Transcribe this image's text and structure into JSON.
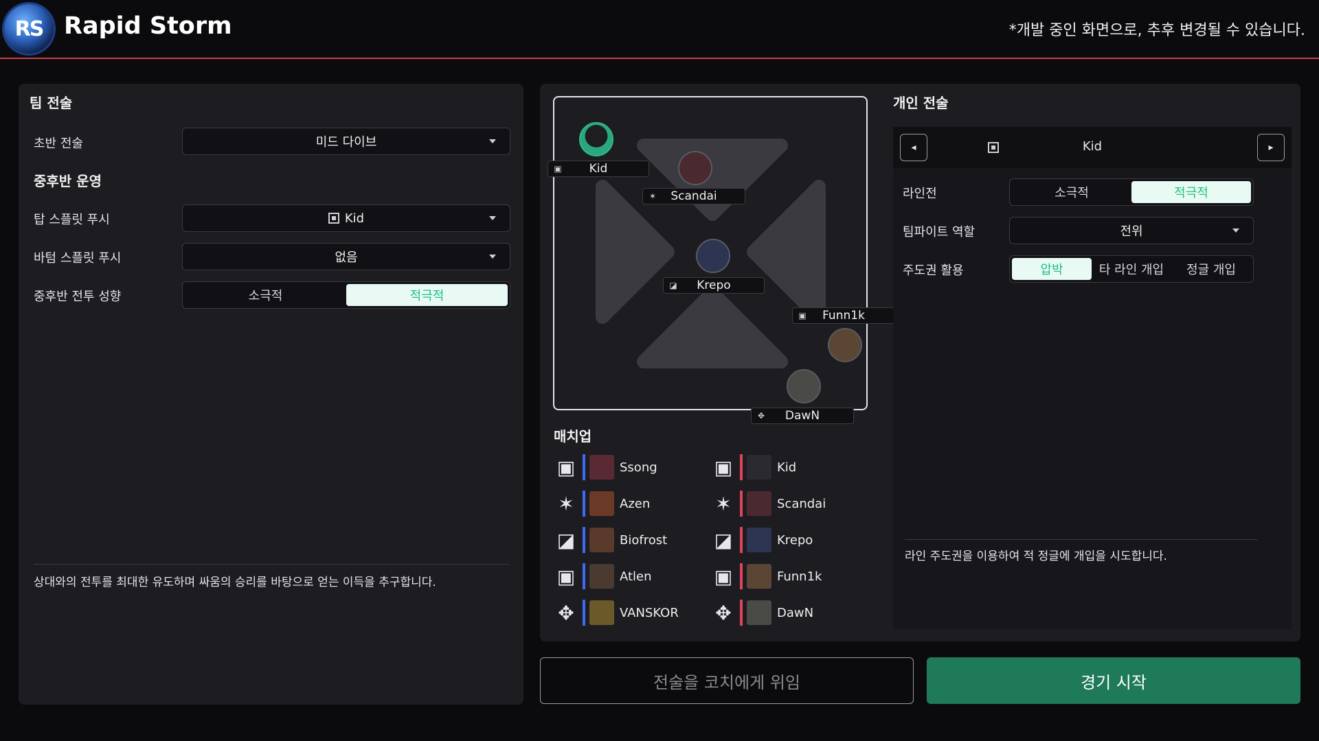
{
  "header": {
    "title": "Rapid Storm",
    "note": "*개발 중인 화면으로, 추후 변경될 수 있습니다.",
    "logo_text": "RS"
  },
  "team_tactics": {
    "title": "팀 전술",
    "early_label": "초반 전술",
    "early_value": "미드 다이브",
    "mid_late_title": "중후반 운영",
    "top_split_label": "탑 스플릿 푸시",
    "top_split_value": "Kid",
    "bottom_split_label": "바텀 스플릿 푸시",
    "bottom_split_value": "없음",
    "combat_label": "중후반 전투 성향",
    "combat_options": [
      "소극적",
      "적극적"
    ],
    "combat_selected": "적극적",
    "description": "상대와의 전투를 최대한 유도하며 싸움의 승리를 바탕으로 얻는 이득을 추구합니다."
  },
  "map": {
    "players": [
      "Kid",
      "Scandai",
      "Krepo",
      "Funn1k",
      "DawN"
    ]
  },
  "matchup": {
    "title": "매치업",
    "blue": [
      "Ssong",
      "Azen",
      "Biofrost",
      "Atlen",
      "VANSKOR"
    ],
    "red": [
      "Kid",
      "Scandai",
      "Krepo",
      "Funn1k",
      "DawN"
    ],
    "roles": [
      "top-icon",
      "jungle-icon",
      "mid-icon",
      "bot-icon",
      "support-icon"
    ]
  },
  "individual": {
    "title": "개인 전술",
    "selected_player": "Kid",
    "lane_label": "라인전",
    "lane_options": [
      "소극적",
      "적극적"
    ],
    "lane_selected": "적극적",
    "teamfight_label": "팀파이트 역할",
    "teamfight_value": "전위",
    "priority_label": "주도권 활용",
    "priority_options": [
      "압박",
      "타 라인 개입",
      "정글 개입"
    ],
    "priority_selected": "압박",
    "description": "라인 주도권을 이용하여 적 정글에 개입을 시도합니다."
  },
  "buttons": {
    "delegate": "전술을 코치에게 위임",
    "start": "경기 시작"
  },
  "colors": {
    "accent_green": "#1fbf86",
    "start_button": "#1f7a5a",
    "header_line": "#c8404e",
    "blue_team": "#3d6cf0",
    "red_team": "#e0445a"
  }
}
